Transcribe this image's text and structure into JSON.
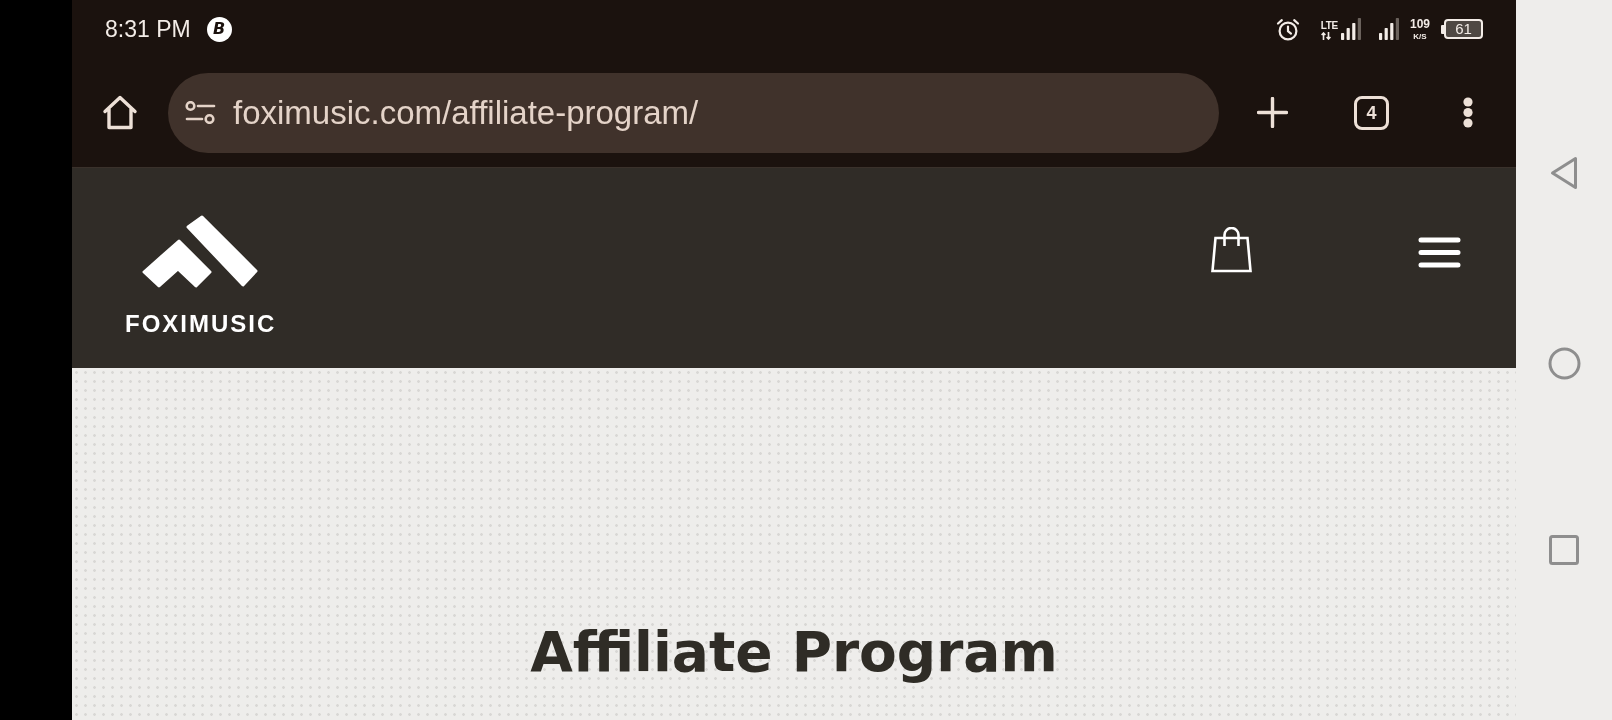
{
  "status_bar": {
    "time": "8:31 PM",
    "notification": "B",
    "network_type": "LTE",
    "speed": "109",
    "speed_unit": "K/S",
    "battery": "61"
  },
  "browser_toolbar": {
    "url": "foximusic.com/affiliate-program/",
    "tab_count": "4"
  },
  "site_header": {
    "brand": "FOXIMUSIC"
  },
  "page": {
    "title": "Affiliate Program"
  }
}
